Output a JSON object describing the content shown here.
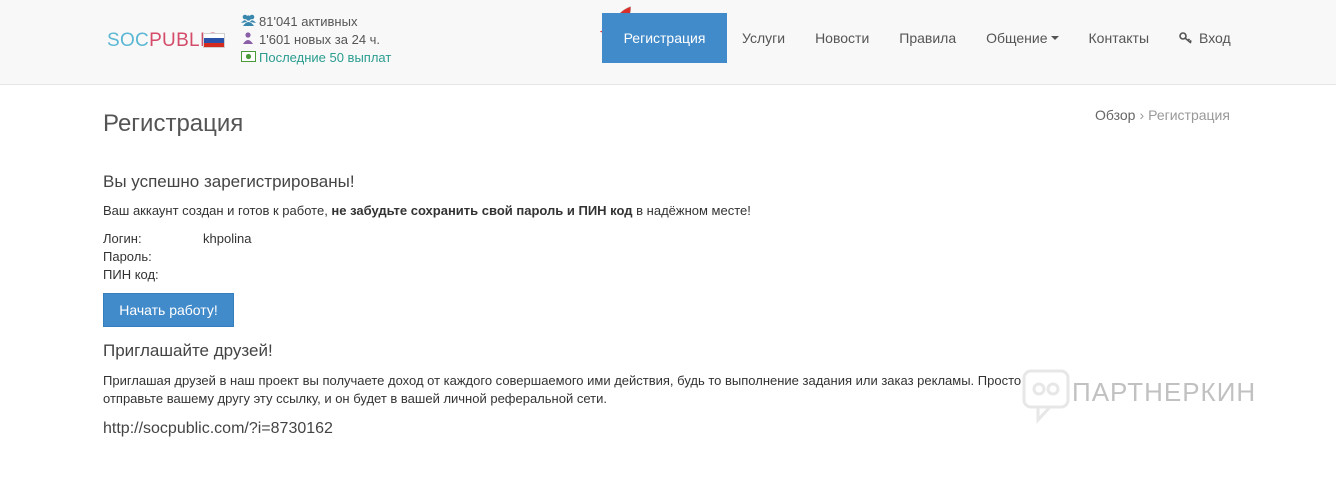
{
  "header": {
    "logo": {
      "part1": "SOC",
      "part2": "PUBLIC"
    },
    "flag": {
      "colors": [
        "#ffffff",
        "#2b51a8",
        "#d52b1e"
      ]
    },
    "stats": {
      "active": "81'041 активных",
      "new": "1'601 новых за 24 ч.",
      "payouts": "Последние 50 выплат"
    },
    "nav": {
      "register": "Регистрация",
      "services": "Услуги",
      "news": "Новости",
      "rules": "Правила",
      "community": "Общение",
      "contacts": "Контакты",
      "login": "Вход"
    }
  },
  "page": {
    "title": "Регистрация",
    "breadcrumb": {
      "home": "Обзор",
      "current": "Регистрация"
    }
  },
  "success": {
    "heading": "Вы успешно зарегистрированы!",
    "msg_start": "Ваш аккаунт создан и готов к работе, ",
    "msg_bold": "не забудьте сохранить свой пароль и ПИН код",
    "msg_end": " в надёжном месте!",
    "login_label": "Логин:",
    "login_value": "khpolina",
    "password_label": "Пароль:",
    "pin_label": "ПИН код:",
    "start_button": "Начать работу!"
  },
  "invite": {
    "heading": "Приглашайте друзей!",
    "text": "Приглашая друзей в наш проект вы получаете доход от каждого совершаемого ими действия, будь то выполнение задания или заказ рекламы. Просто отправьте вашему другу эту ссылку, и он будет в вашей личной реферальной сети.",
    "link": "http://socpublic.com/?i=8730162"
  },
  "watermark": {
    "text": "ПАРТНЕРКИН"
  },
  "colors": {
    "accent": "#428bca",
    "logo_blue": "#5bb8d4",
    "logo_red": "#d44c6a",
    "link_green": "#2a9d8f"
  }
}
